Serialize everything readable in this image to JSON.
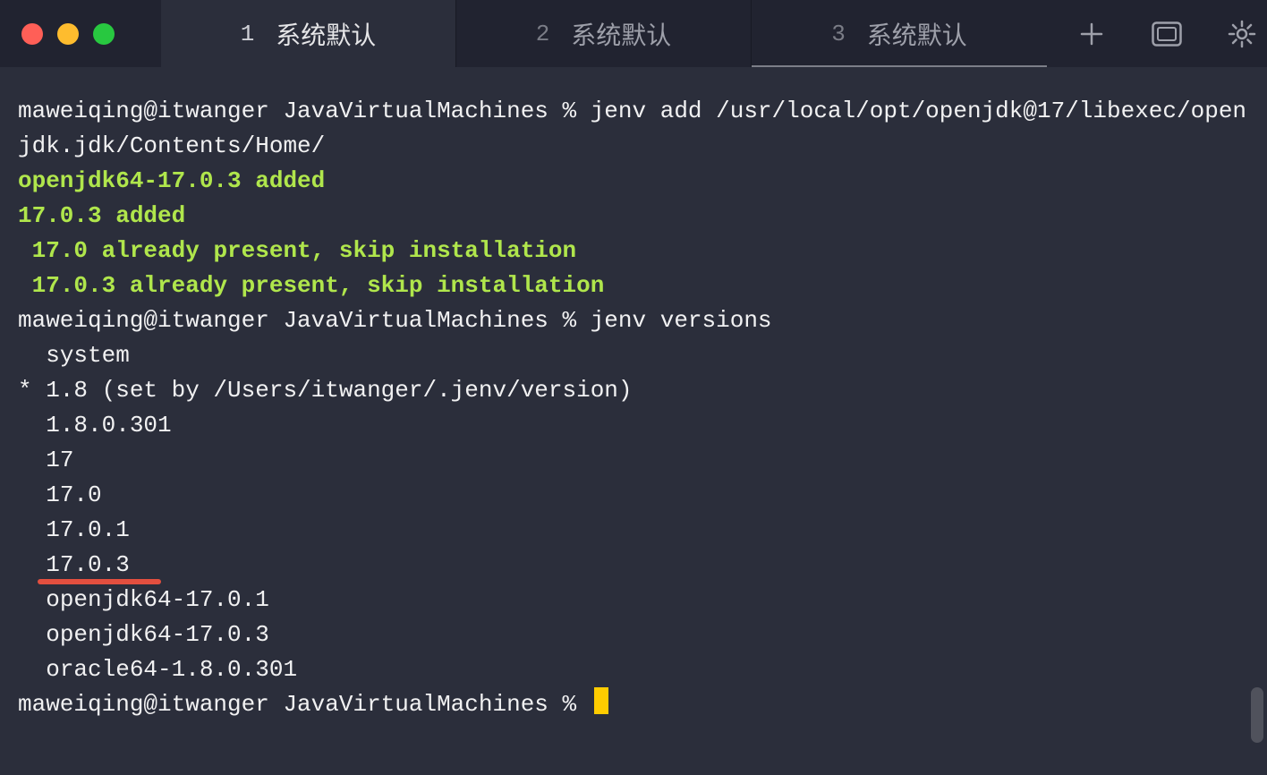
{
  "tabs": [
    {
      "index": "1",
      "label": "系统默认",
      "active": true
    },
    {
      "index": "2",
      "label": "系统默认",
      "active": false
    },
    {
      "index": "3",
      "label": "系统默认",
      "active": false
    }
  ],
  "toolbar_icons": {
    "new_tab": "+",
    "panels": "panels",
    "settings": "gear"
  },
  "prompt": "maweiqing@itwanger JavaVirtualMachines % ",
  "commands": {
    "jenv_add": "jenv add /usr/local/opt/openjdk@17/libexec/openjdk.jdk/Contents/Home/",
    "jenv_versions": "jenv versions"
  },
  "output": {
    "added1": "openjdk64-17.0.3 added",
    "added2": "17.0.3 added",
    "skip1": " 17.0 already present, skip installation",
    "skip2": " 17.0.3 already present, skip installation",
    "versions": [
      "  system",
      "* 1.8 (set by /Users/itwanger/.jenv/version)",
      "  1.8.0.301",
      "  17",
      "  17.0",
      "  17.0.1",
      "  17.0.3",
      "  openjdk64-17.0.1",
      "  openjdk64-17.0.3",
      "  oracle64-1.8.0.301"
    ]
  },
  "underlined_version_index": 6
}
